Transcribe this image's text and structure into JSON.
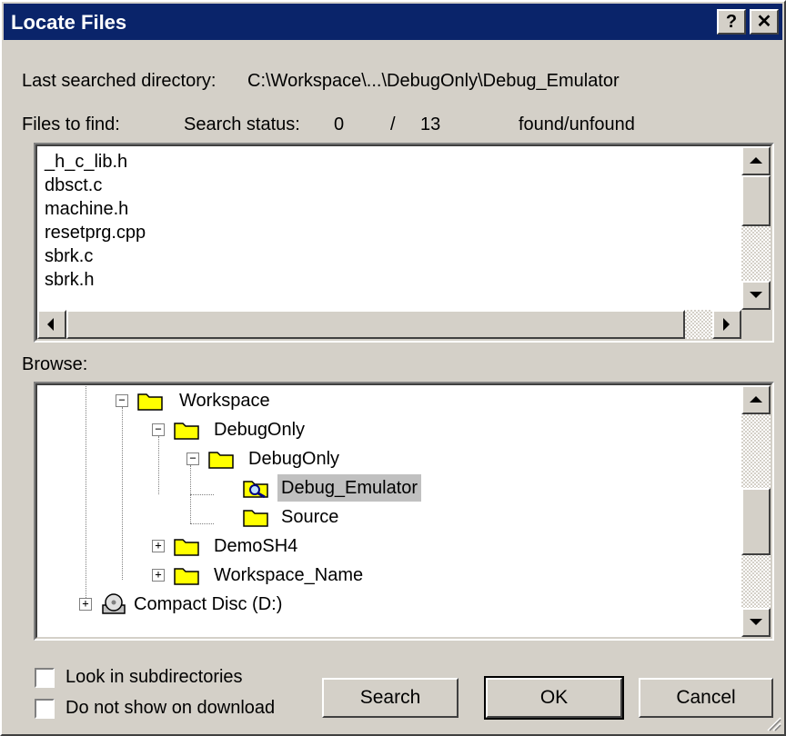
{
  "window": {
    "title": "Locate Files",
    "help_glyph": "?",
    "close_glyph": "✕"
  },
  "info": {
    "last_searched_label": "Last searched directory:",
    "last_searched_value": "C:\\Workspace\\...\\DebugOnly\\Debug_Emulator",
    "files_to_find_label": "Files to find:",
    "search_status_label": "Search status:",
    "found_count": "0",
    "separator": "/",
    "unfound_count": "13",
    "status_suffix": "found/unfound"
  },
  "files": [
    "_h_c_lib.h",
    "dbsct.c",
    "machine.h",
    "resetprg.cpp",
    "sbrk.c",
    "sbrk.h"
  ],
  "browse": {
    "label": "Browse:",
    "nodes": [
      {
        "label": "Workspace",
        "expander": "−",
        "icon": "folder-open-icon"
      },
      {
        "label": "DebugOnly",
        "expander": "−",
        "icon": "folder-open-icon"
      },
      {
        "label": "DebugOnly",
        "expander": "−",
        "icon": "folder-open-icon"
      },
      {
        "label": "Debug_Emulator",
        "expander": "",
        "icon": "folder-search-icon",
        "selected": true
      },
      {
        "label": "Source",
        "expander": "",
        "icon": "folder-icon"
      },
      {
        "label": "DemoSH4",
        "expander": "+",
        "icon": "folder-icon"
      },
      {
        "label": "Workspace_Name",
        "expander": "+",
        "icon": "folder-icon"
      },
      {
        "label": "Compact Disc (D:)",
        "expander": "+",
        "icon": "cd-drive-icon"
      }
    ]
  },
  "options": {
    "look_in_subdirs": {
      "label": "Look in subdirectories",
      "checked": false
    },
    "no_show_on_download": {
      "label": "Do not show on download",
      "checked": false
    }
  },
  "buttons": {
    "search": "Search",
    "ok": "OK",
    "cancel": "Cancel"
  },
  "colors": {
    "title_bar": "#0a246a",
    "face": "#d4d0c8",
    "folder": "#ffff00",
    "selection": "#c0c0c0"
  }
}
